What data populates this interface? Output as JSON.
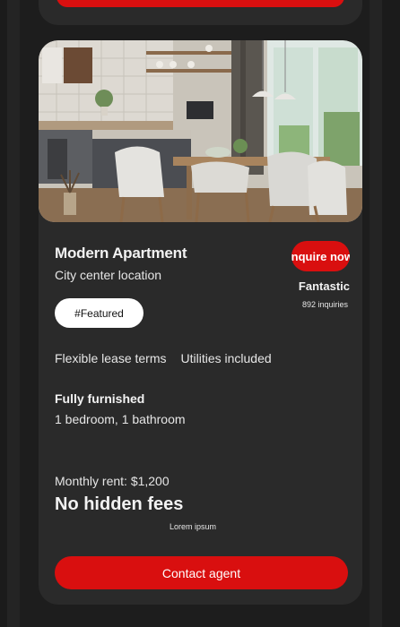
{
  "listing": {
    "title": "Modern Apartment",
    "location": "City center location",
    "tag": "#Featured",
    "inquire_label": "Inquire now",
    "rating": "Fantastic",
    "inquiries": "892 inquiries",
    "features": [
      "Flexible lease terms",
      "Utilities included"
    ],
    "furnished": "Fully furnished",
    "rooms": "1 bedroom, 1 bathroom",
    "rent": "Monthly rent: $1,200",
    "fees": "No hidden fees",
    "note": "Lorem ipsum",
    "contact_label": "Contact agent"
  },
  "colors": {
    "accent": "#d90f0f",
    "card": "#2a2a2a",
    "background": "#1b1b1b"
  }
}
